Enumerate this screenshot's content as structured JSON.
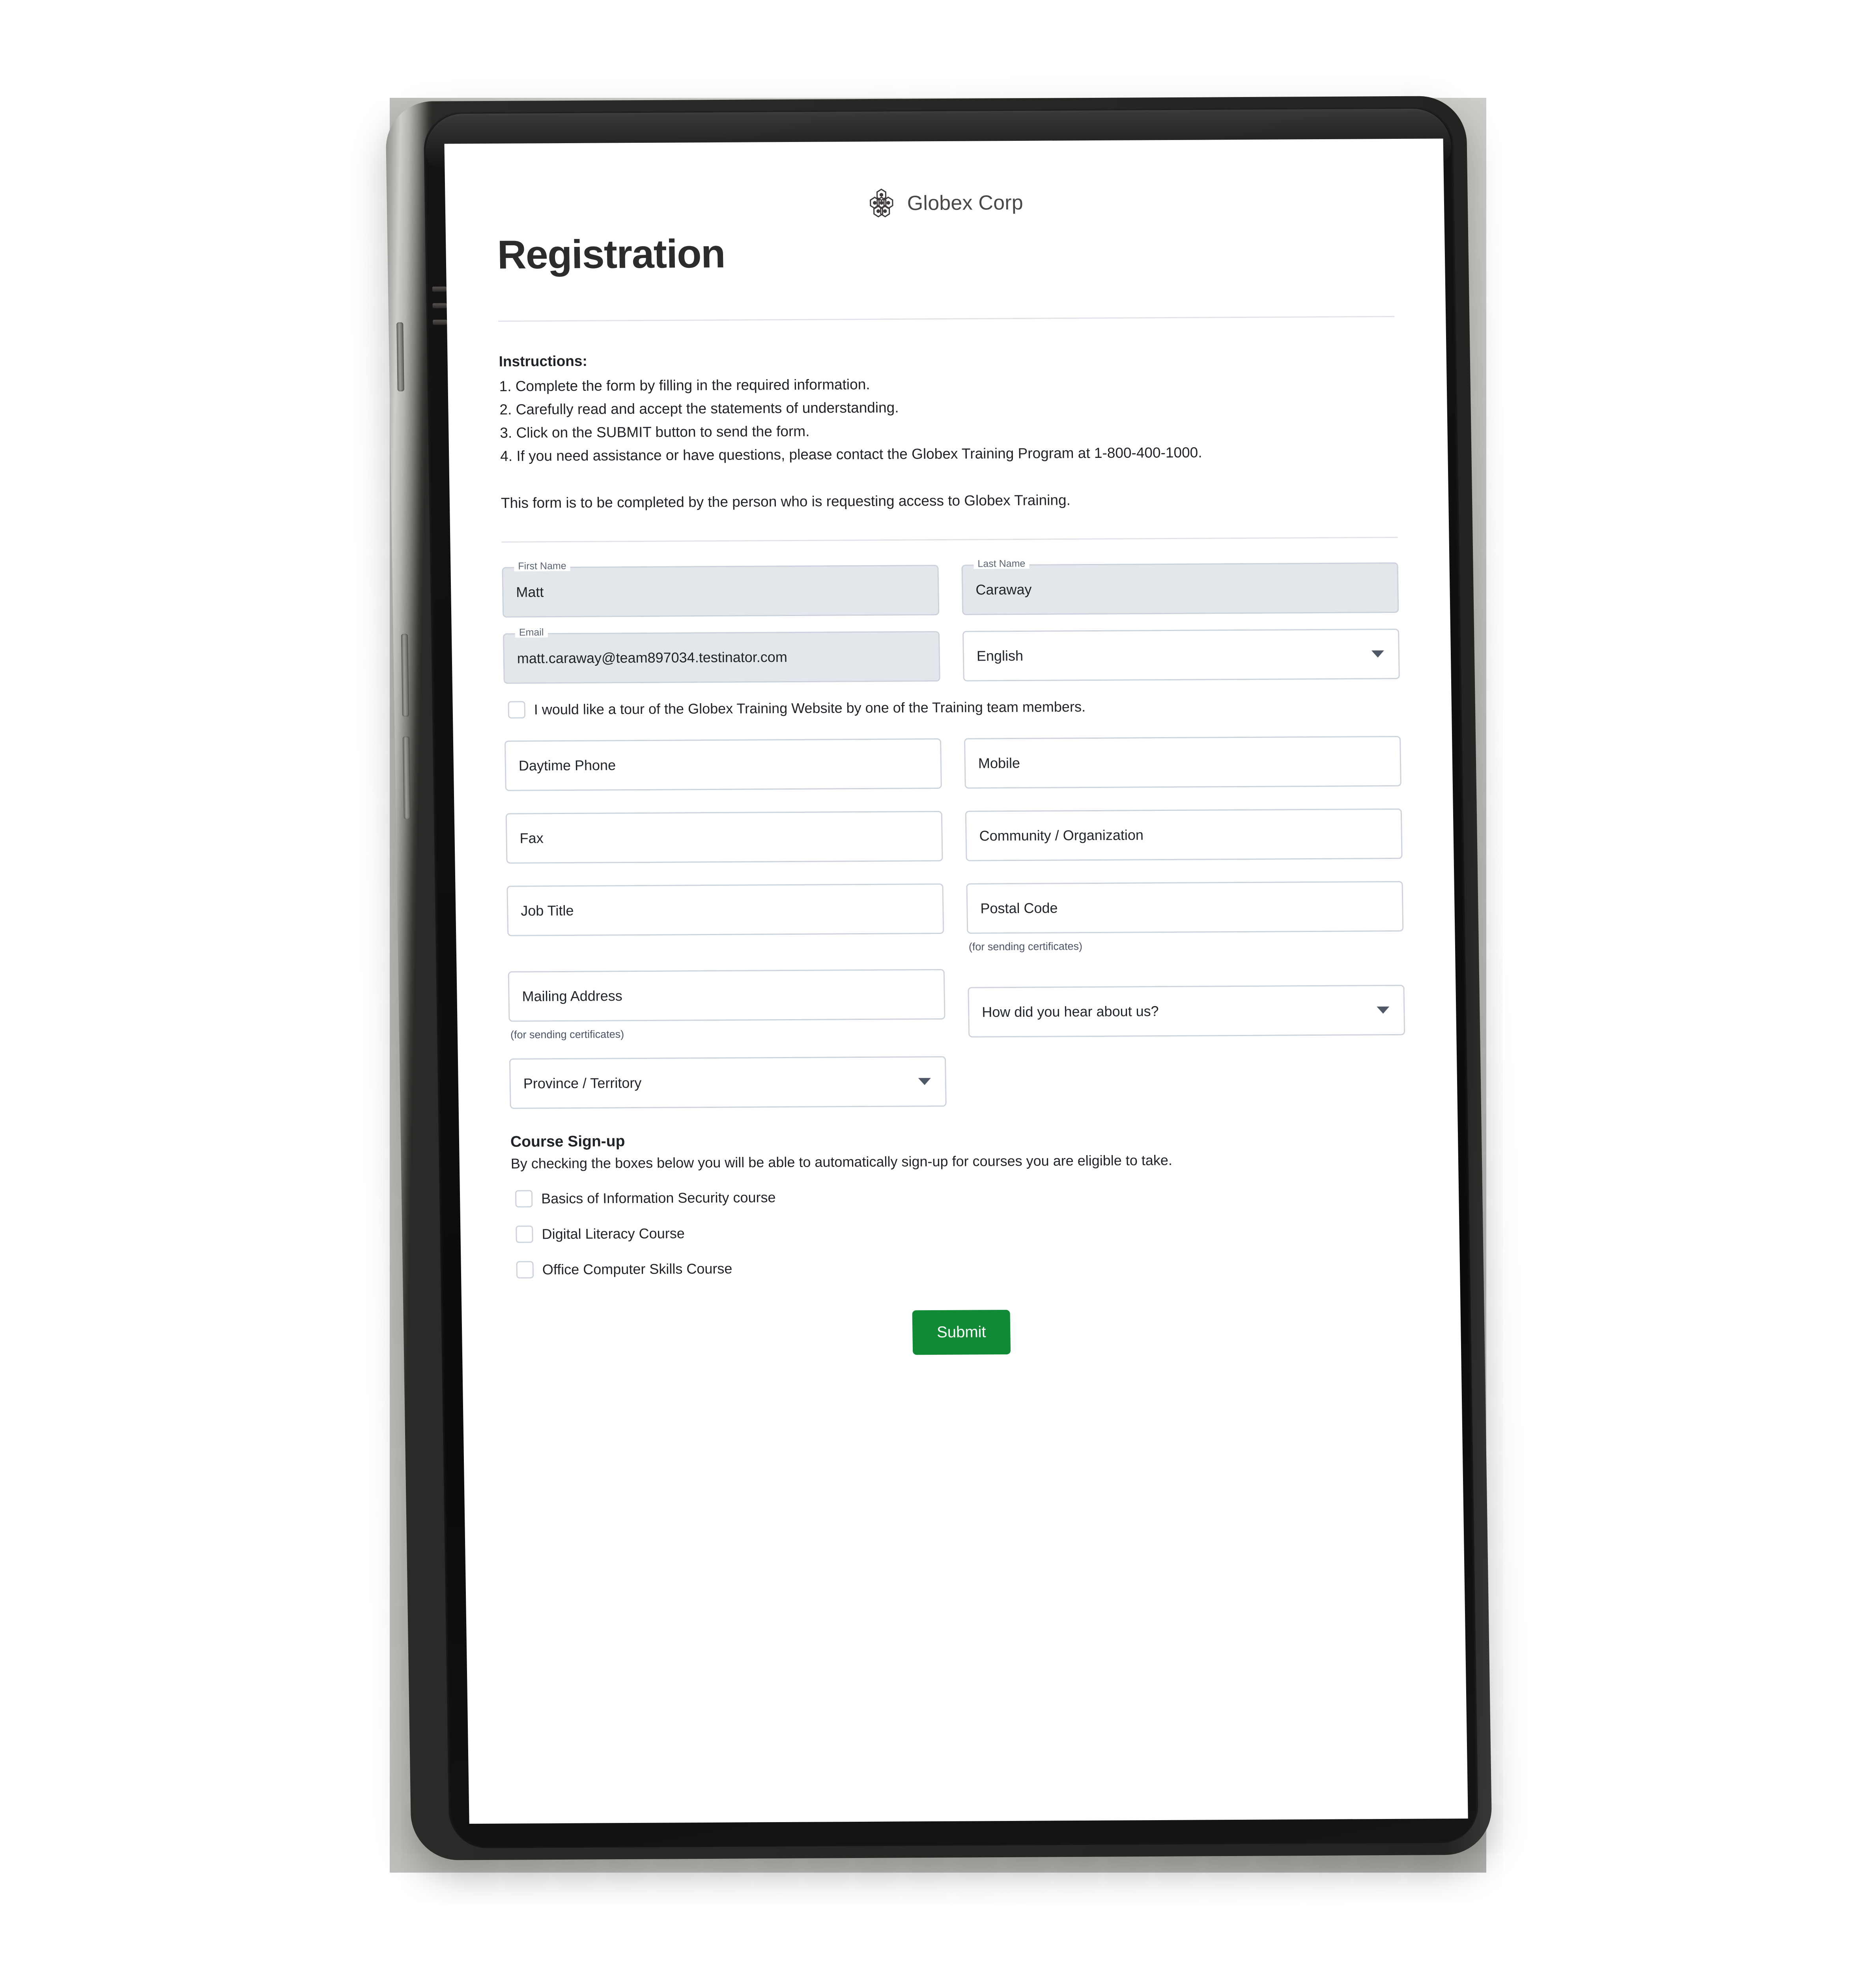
{
  "brand": {
    "logo_icon": "honeycomb-logo-icon",
    "name": "Globex Corp"
  },
  "page": {
    "title": "Registration"
  },
  "instructions": {
    "heading": "Instructions:",
    "items": [
      "1. Complete the form by filling in the required information.",
      "2. Carefully read and accept the statements of understanding.",
      "3. Click on the SUBMIT button to send the form.",
      "4. If you need assistance or have questions, please contact the Globex Training Program at 1-800-400-1000."
    ],
    "note": "This form is to be completed by the person who is requesting access to Globex Training."
  },
  "form": {
    "first_name": {
      "label": "First Name",
      "value": "Matt"
    },
    "last_name": {
      "label": "Last Name",
      "value": "Caraway"
    },
    "email": {
      "label": "Email",
      "value": "matt.caraway@team897034.testinator.com"
    },
    "language": {
      "value": "English",
      "chevron_icon": "chevron-down-icon"
    },
    "tour_checkbox": {
      "label": "I would like a tour of the Globex Training Website by one of the Training team members.",
      "checked": false
    },
    "daytime_phone": {
      "placeholder": "Daytime Phone",
      "value": ""
    },
    "mobile": {
      "placeholder": "Mobile",
      "value": ""
    },
    "fax": {
      "placeholder": "Fax",
      "value": ""
    },
    "community_organization": {
      "placeholder": "Community / Organization",
      "value": ""
    },
    "job_title": {
      "placeholder": "Job Title",
      "value": ""
    },
    "postal_code": {
      "placeholder": "Postal Code",
      "value": "",
      "helper": "(for sending certificates)"
    },
    "mailing_address": {
      "placeholder": "Mailing Address",
      "value": "",
      "helper": "(for sending certificates)"
    },
    "hear_about_us": {
      "placeholder": "How did you hear about us?",
      "chevron_icon": "chevron-down-icon"
    },
    "province_territory": {
      "placeholder": "Province / Territory",
      "chevron_icon": "chevron-down-icon"
    }
  },
  "course_signup": {
    "heading": "Course Sign-up",
    "subtext": "By checking the boxes below you will be able to automatically sign-up for courses you are eligible to take.",
    "courses": [
      {
        "label": "Basics of Information Security course",
        "checked": false
      },
      {
        "label": "Digital Literacy Course",
        "checked": false
      },
      {
        "label": "Office Computer Skills Course",
        "checked": false
      }
    ]
  },
  "actions": {
    "submit_label": "Submit"
  },
  "colors": {
    "submit_green": "#108a34",
    "field_border": "#ccd3dc",
    "filled_field_bg": "#e3e7ec",
    "label_gray": "#5a6472",
    "rule_gray": "#dfe3e8",
    "text": "#1f2328"
  }
}
